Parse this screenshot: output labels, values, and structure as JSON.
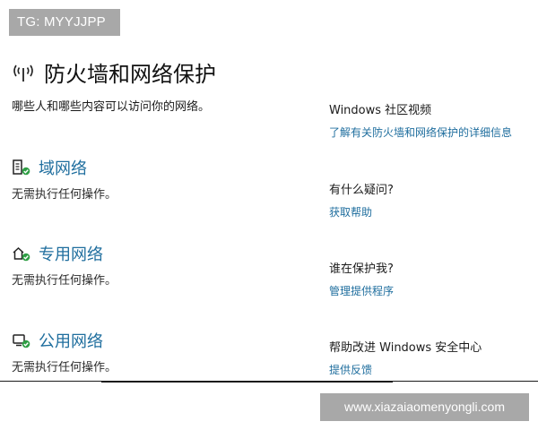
{
  "watermark_top": "TG: MYYJJPP",
  "page": {
    "title": "防火墙和网络保护",
    "subtitle": "哪些人和哪些内容可以访问你的网络。",
    "title_icon": "wifi-antenna-icon"
  },
  "networks": [
    {
      "name": "域网络",
      "status": "无需执行任何操作。",
      "icon": "domain-network-icon"
    },
    {
      "name": "专用网络",
      "status": "无需执行任何操作。",
      "icon": "private-network-icon"
    },
    {
      "name": "公用网络",
      "status": "无需执行任何操作。",
      "icon": "public-network-icon"
    }
  ],
  "side": [
    {
      "heading": "Windows 社区视频",
      "link": "了解有关防火墙和网络保护的详细信息"
    },
    {
      "heading": "有什么疑问?",
      "link": "获取帮助"
    },
    {
      "heading": "谁在保护我?",
      "link": "管理提供程序"
    },
    {
      "heading": "帮助改进 Windows 安全中心",
      "link": "提供反馈"
    }
  ],
  "watermark_bottom": "www.xiazaiaomenyongli.com",
  "colors": {
    "link": "#1f6e9e",
    "check": "#2e9e44",
    "watermark_bg": "#a8a8a8"
  }
}
